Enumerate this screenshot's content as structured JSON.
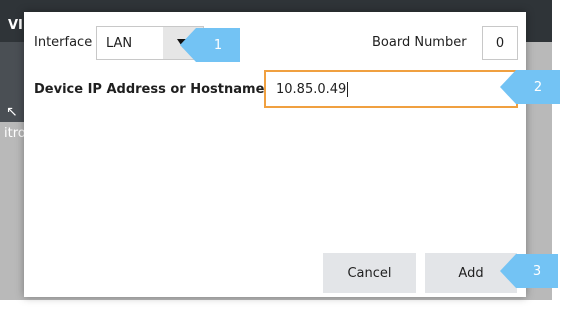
{
  "background_app": {
    "title_fragment": "VI",
    "toolbar_fragment": "itro"
  },
  "dialog": {
    "interface_label": "Interface",
    "interface_value": "LAN",
    "board_number_label": "Board Number",
    "board_number_value": "0",
    "ip_label": "Device IP Address or Hostname",
    "ip_value": "10.85.0.49",
    "cancel_label": "Cancel",
    "add_label": "Add"
  },
  "callouts": [
    {
      "number": "1"
    },
    {
      "number": "2"
    },
    {
      "number": "3"
    }
  ],
  "colors": {
    "focus_border": "#f0a040",
    "callout": "#73c3f4",
    "button_bg": "#e3e5e8",
    "titlebar": "#2f3438"
  },
  "icons": {
    "dropdown": "triangle-down",
    "cursor": "arrow-pointer"
  }
}
